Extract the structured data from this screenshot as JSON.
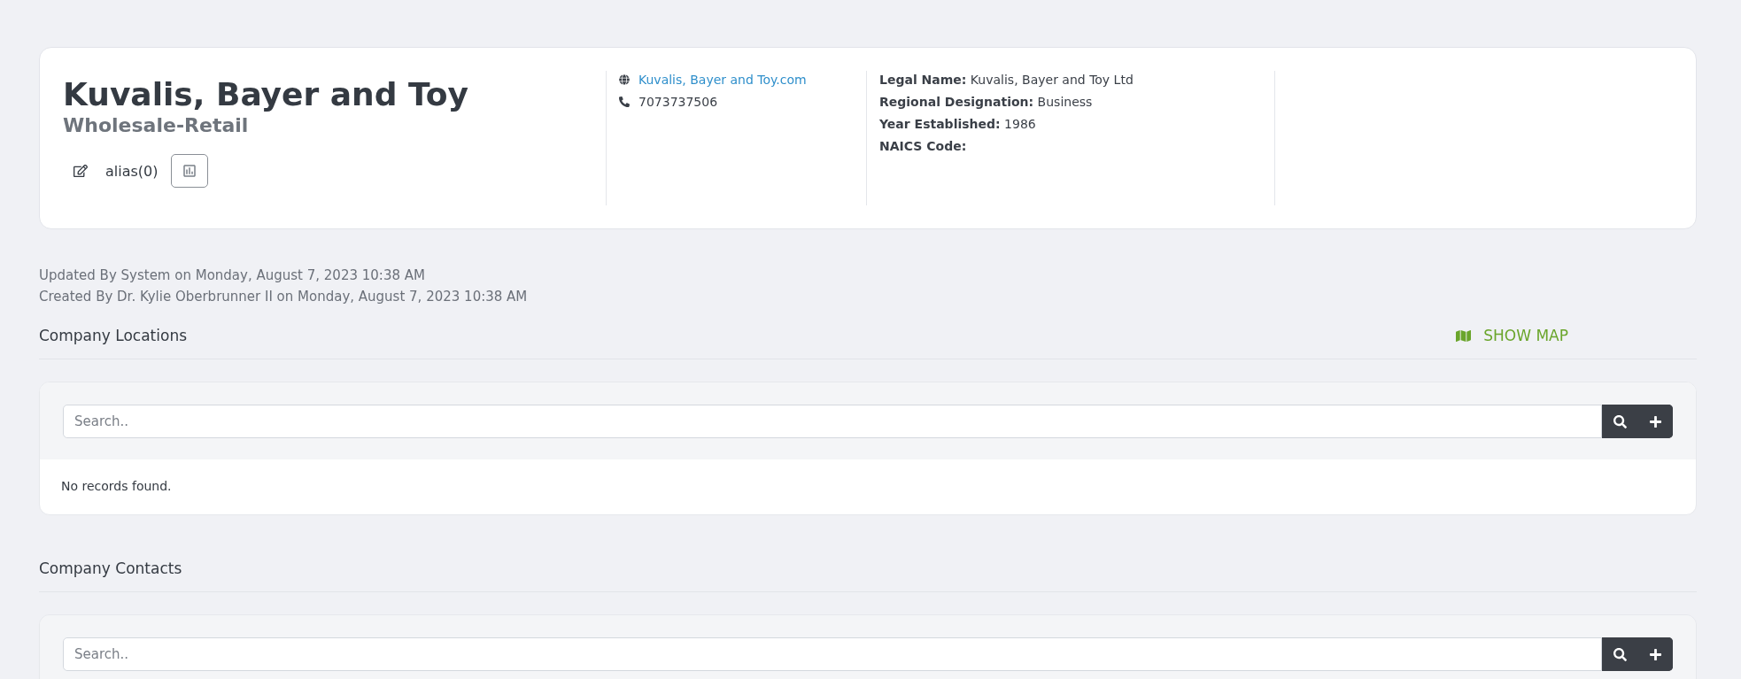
{
  "company": {
    "name": "Kuvalis, Bayer and Toy",
    "category": "Wholesale-Retail",
    "alias": "alias(0)",
    "website": "Kuvalis, Bayer and Toy.com",
    "phone": "7073737506",
    "details": [
      {
        "label": "Legal Name:",
        "value": "Kuvalis, Bayer and Toy Ltd"
      },
      {
        "label": "Regional Designation:",
        "value": "Business"
      },
      {
        "label": "Year Established:",
        "value": "1986"
      },
      {
        "label": "NAICS Code:"
      }
    ]
  },
  "audit": [
    "Updated By System on Monday, August 7, 2023 10:38 AM",
    "Created By Dr. Kylie Oberbrunner II on Monday, August 7, 2023 10:38 AM"
  ],
  "sections": [
    {
      "title": "Company Locations",
      "map_button": "SHOW MAP",
      "search": {
        "placeholder": "Search.."
      },
      "empty_text": "No records found."
    },
    {
      "title": "Company Contacts",
      "search": {
        "placeholder": "Search.."
      }
    }
  ]
}
